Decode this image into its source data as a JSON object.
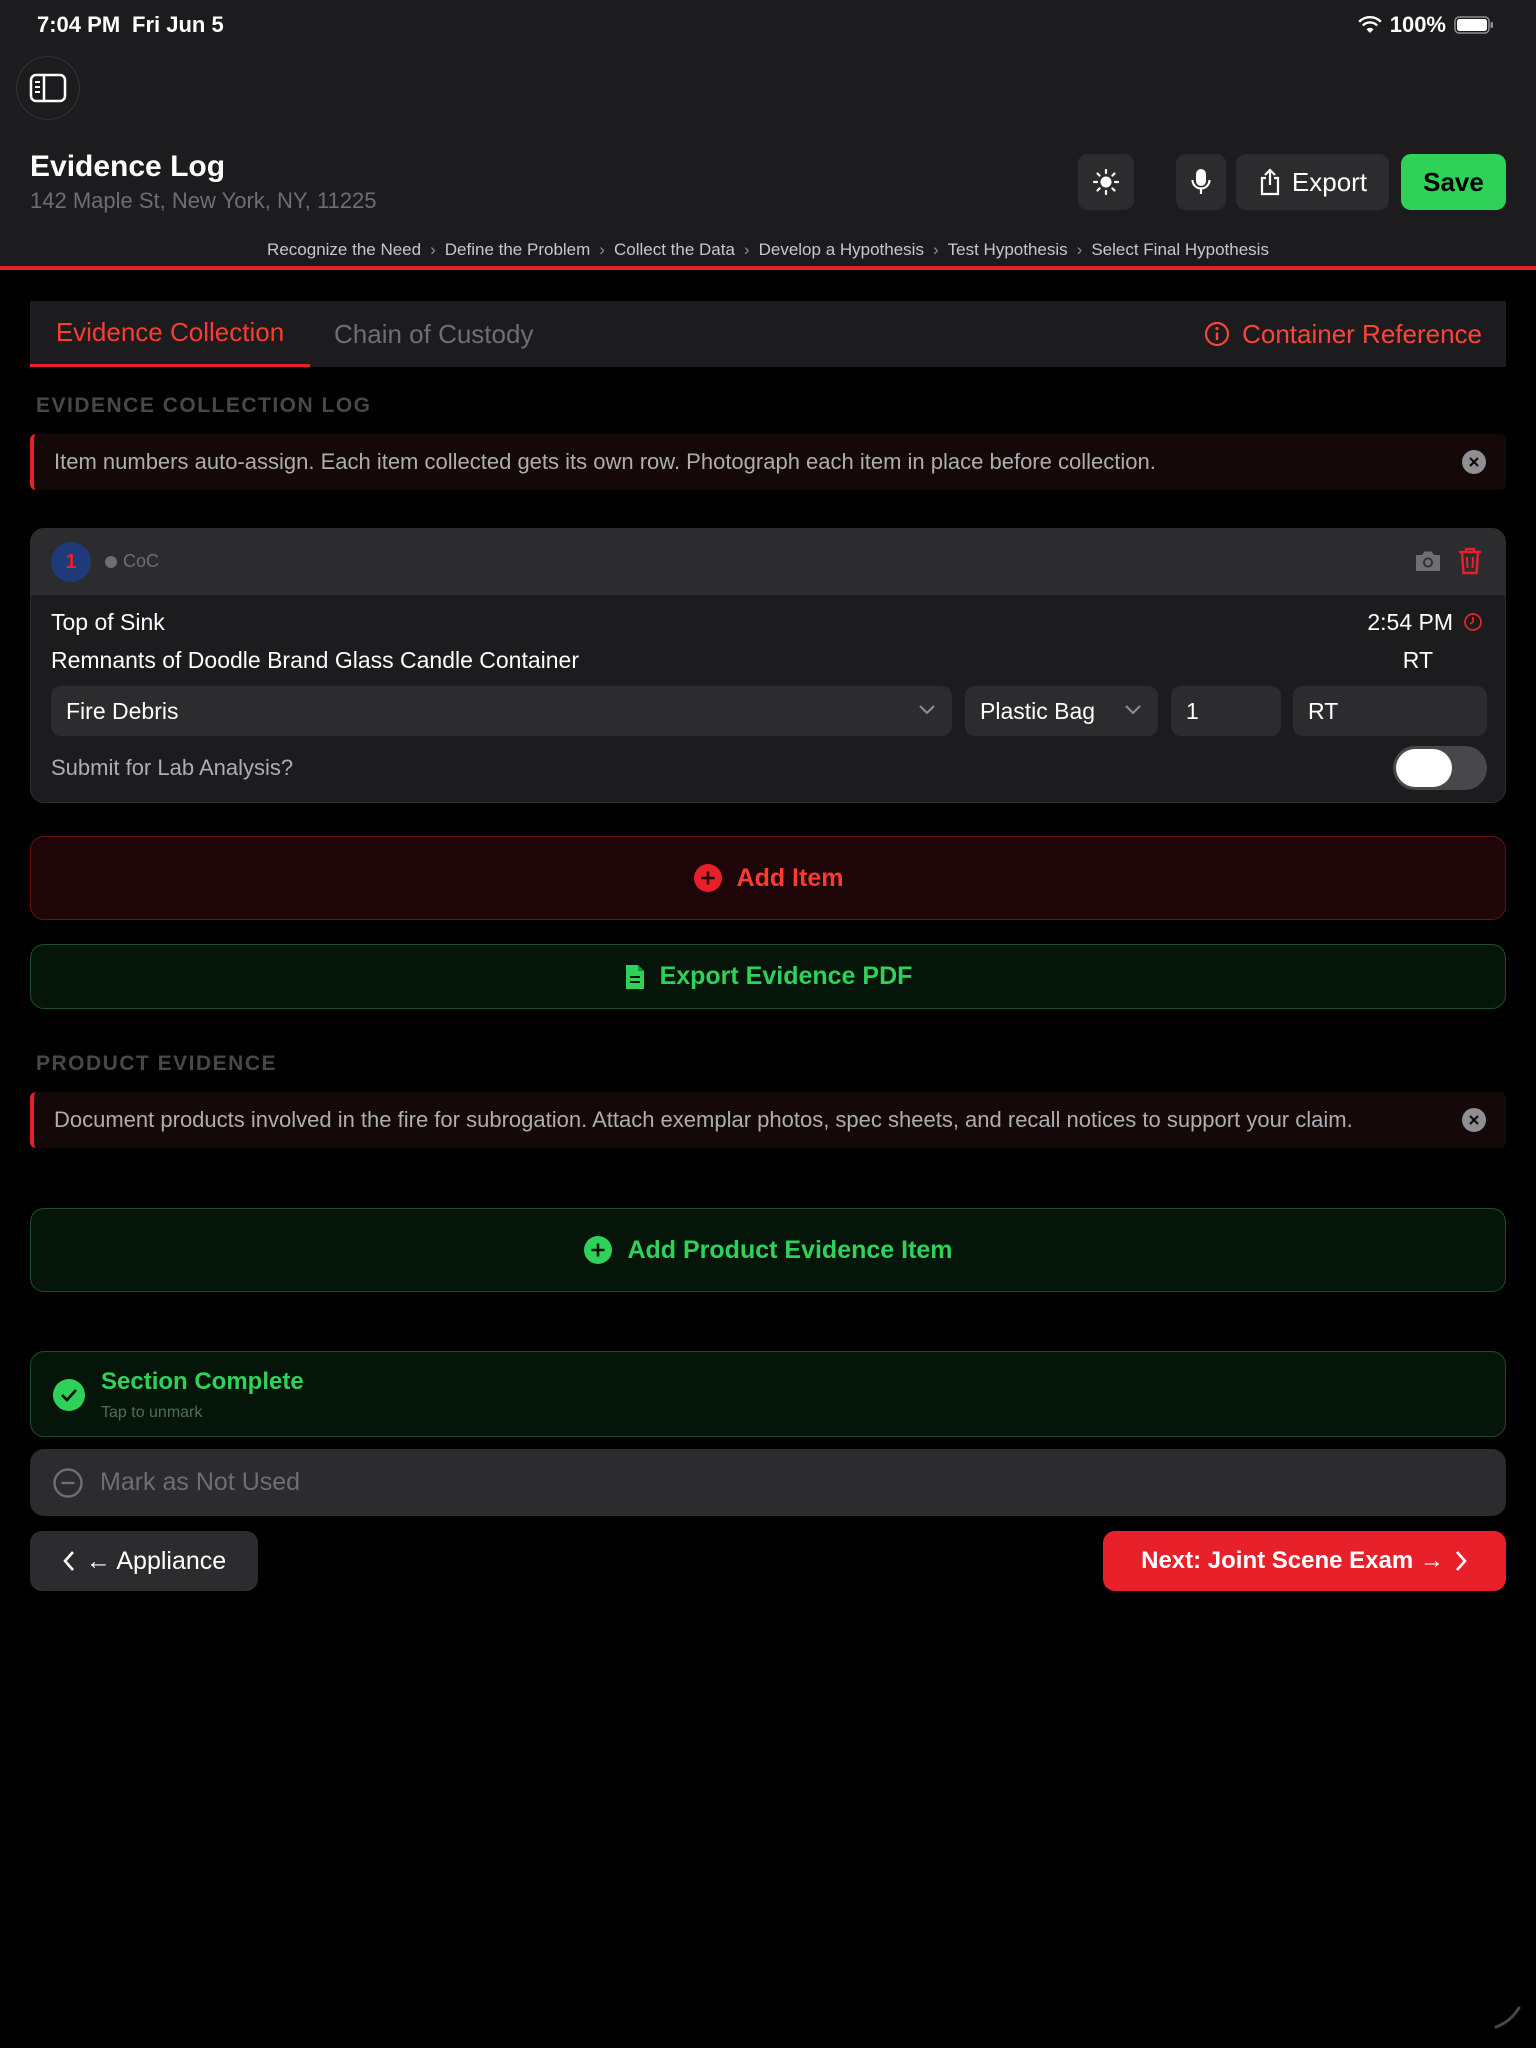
{
  "status": {
    "time": "7:04 PM",
    "date": "Fri Jun 5",
    "battery": "100%"
  },
  "header": {
    "title": "Evidence Log",
    "address": "142 Maple St, New York, NY, 11225",
    "export_label": "Export",
    "save_label": "Save"
  },
  "steps": [
    "Recognize the Need",
    "Define the Problem",
    "Collect the Data",
    "Develop a Hypothesis",
    "Test Hypothesis",
    "Select Final Hypothesis"
  ],
  "step_separator": "›",
  "tabs": {
    "active": "Evidence Collection",
    "inactive": "Chain of Custody",
    "reference": "Container Reference"
  },
  "collection": {
    "section_label": "EVIDENCE COLLECTION LOG",
    "banner": "Item numbers auto-assign. Each item collected gets its own row. Photograph each item in place before collection.",
    "item": {
      "number": "1",
      "coc_label": "CoC",
      "location": "Top of Sink",
      "description": "Remnants of Doodle Brand Glass Candle Container",
      "time": "2:54 PM",
      "initials_display": "RT",
      "type": "Fire Debris",
      "container": "Plastic Bag",
      "quantity": "1",
      "initials": "RT",
      "lab_question": "Submit for Lab Analysis?"
    },
    "add_item_label": "Add Item",
    "export_pdf_label": "Export Evidence PDF"
  },
  "product": {
    "section_label": "PRODUCT EVIDENCE",
    "banner": "Document products involved in the fire for subrogation. Attach exemplar photos, spec sheets, and recall notices to support your claim.",
    "add_label": "Add Product Evidence Item"
  },
  "complete": {
    "title": "Section Complete",
    "subtitle": "Tap to unmark"
  },
  "not_used_label": "Mark as Not Used",
  "nav": {
    "back_label": "← Appliance",
    "next_label": "Next: Joint Scene Exam →"
  },
  "colors": {
    "accent_red": "#e8202a",
    "accent_green": "#30d158",
    "background": "#000000",
    "surface": "#1c1c1e"
  }
}
